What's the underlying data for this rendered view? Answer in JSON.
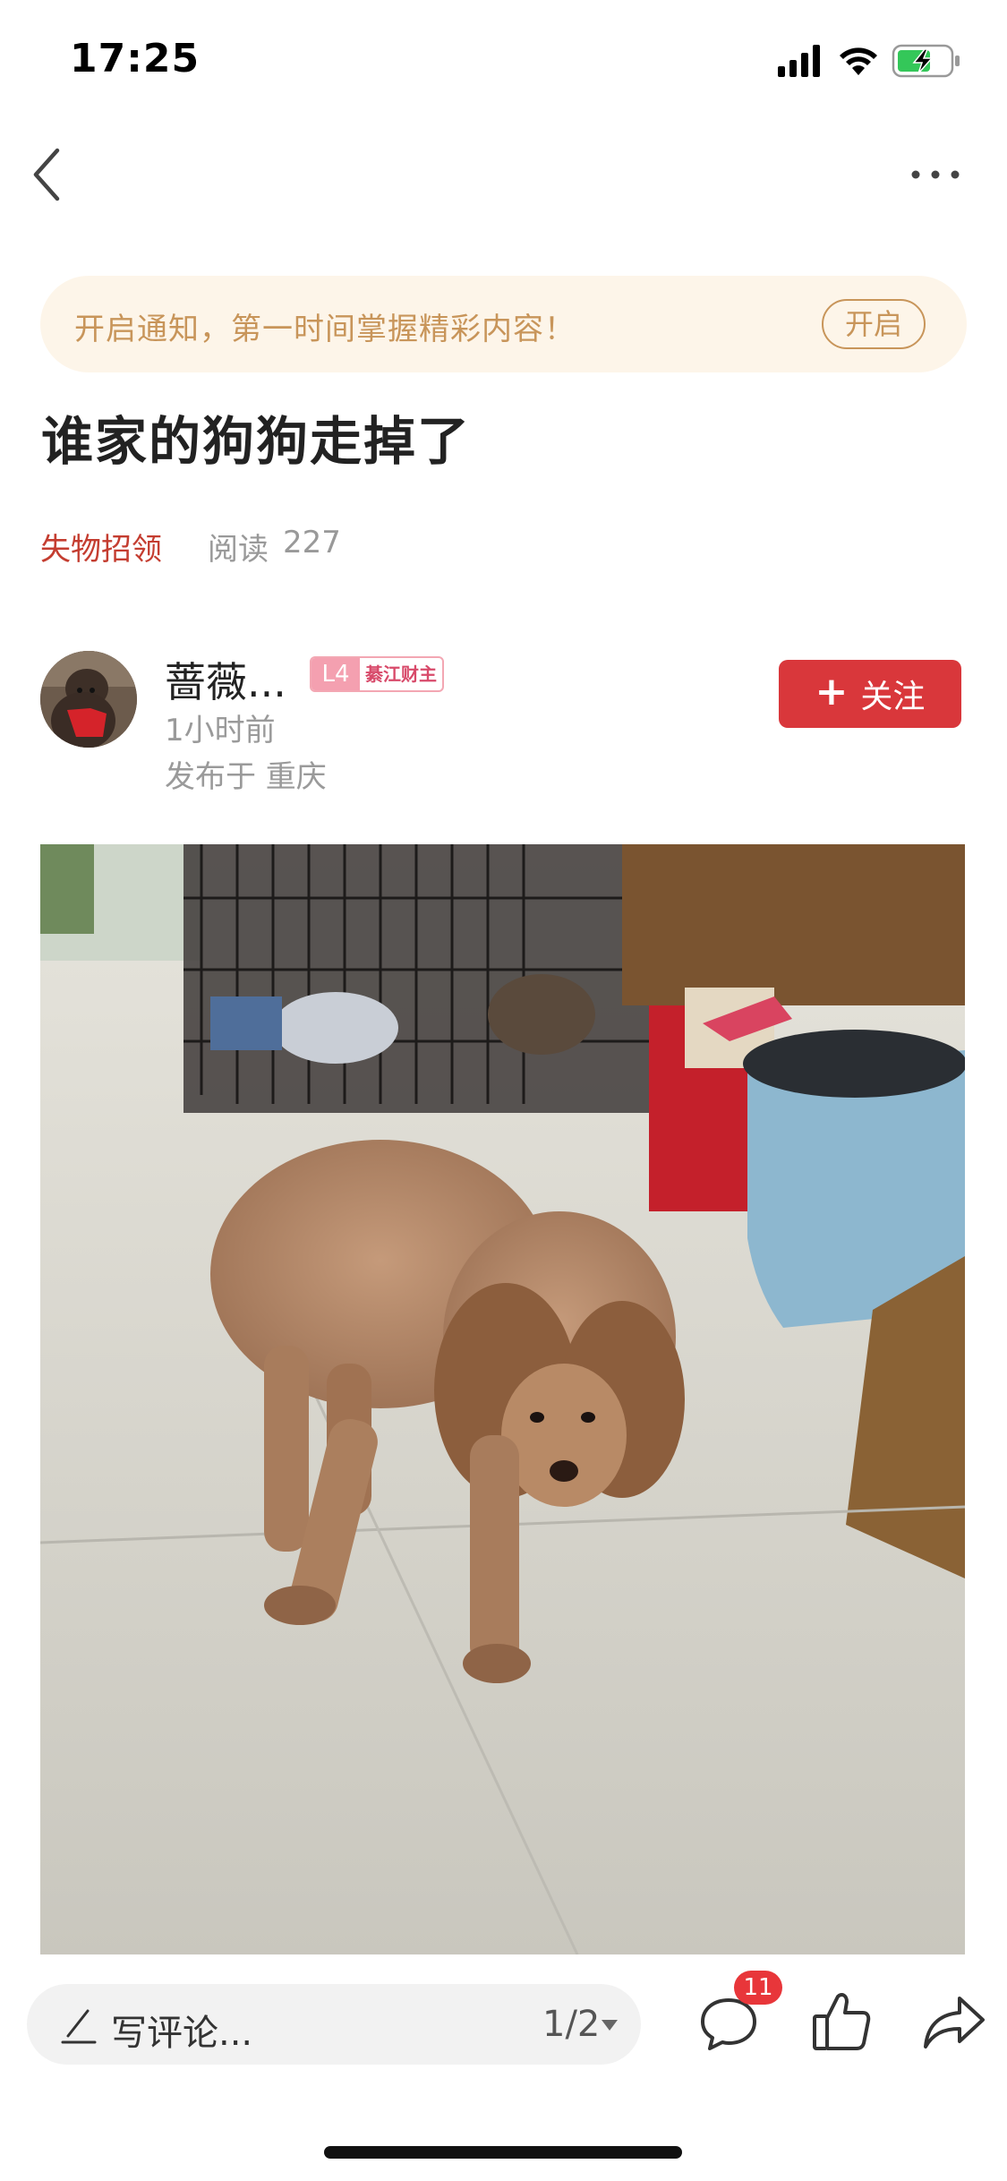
{
  "status_bar": {
    "time": "17:25",
    "icons": [
      "signal-icon",
      "wifi-icon",
      "battery-charging-icon"
    ]
  },
  "nav": {
    "back_icon": "chevron-left-icon",
    "more_icon": "more-dots-icon"
  },
  "notify_banner": {
    "text": "开启通知，第一时间掌握精彩内容！",
    "button_label": "开启",
    "color": "#c8955a",
    "background": "#fdf5e9"
  },
  "post": {
    "title": "谁家的狗狗走掉了",
    "category": "失物招领",
    "read_label": "阅读",
    "read_count": "227"
  },
  "author": {
    "name": "蔷薇...",
    "level": "L4",
    "level_title": "綦江财主",
    "time": "1小时前",
    "location": "发布于 重庆",
    "follow_label": "关注",
    "follow_color": "#d9373b"
  },
  "image": {
    "description_icon": "post-photo"
  },
  "bottom_bar": {
    "comment_placeholder": "写评论...",
    "page_indicator": "1/2",
    "comment_count": "11",
    "icons": [
      "pen-icon",
      "comment-icon",
      "like-icon",
      "share-icon"
    ]
  }
}
